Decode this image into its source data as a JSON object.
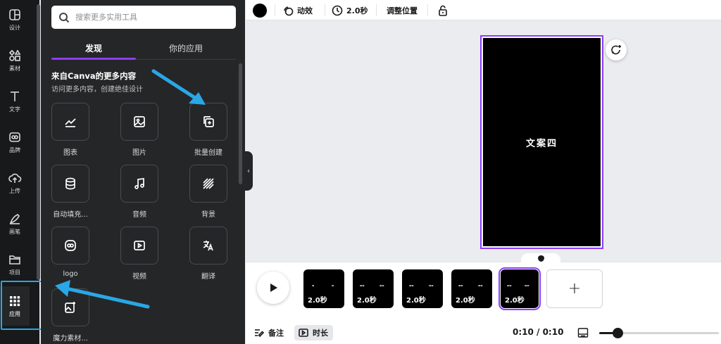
{
  "rail": {
    "items": [
      {
        "label": "设计",
        "icon": "layout-icon"
      },
      {
        "label": "素材",
        "icon": "shapes-icon"
      },
      {
        "label": "文字",
        "icon": "text-icon"
      },
      {
        "label": "品牌",
        "icon": "brand-icon"
      },
      {
        "label": "上传",
        "icon": "upload-cloud-icon"
      },
      {
        "label": "画笔",
        "icon": "draw-icon"
      },
      {
        "label": "项目",
        "icon": "folder-icon"
      },
      {
        "label": "应用",
        "icon": "apps-grid-icon"
      }
    ]
  },
  "panel": {
    "search_placeholder": "搜索更多实用工具",
    "tabs": [
      {
        "label": "发现",
        "active": true
      },
      {
        "label": "你的应用",
        "active": false
      }
    ],
    "section_title": "来自Canva的更多内容",
    "section_subtitle": "访问更多内容，创建绝佳设计",
    "apps": [
      {
        "label": "图表",
        "icon": "chart-icon"
      },
      {
        "label": "图片",
        "icon": "image-icon"
      },
      {
        "label": "批量创建",
        "icon": "bulk-create-icon"
      },
      {
        "label": "自动填充...",
        "icon": "database-icon"
      },
      {
        "label": "音频",
        "icon": "music-icon"
      },
      {
        "label": "背景",
        "icon": "pattern-icon"
      },
      {
        "label": "logo",
        "icon": "logo-icon"
      },
      {
        "label": "视频",
        "icon": "video-icon"
      },
      {
        "label": "翻译",
        "icon": "translate-icon"
      },
      {
        "label": "魔力素材...",
        "icon": "magic-media-icon"
      }
    ]
  },
  "toolbar": {
    "color": "#000000",
    "animate_label": "动效",
    "duration_label": "2.0秒",
    "position_label": "调整位置"
  },
  "canvas": {
    "page_text": "文案四",
    "accent": "#8b3dff"
  },
  "timeline": {
    "pages": [
      {
        "duration": "2.0秒",
        "active": false
      },
      {
        "duration": "2.0秒",
        "active": false
      },
      {
        "duration": "2.0秒",
        "active": false
      },
      {
        "duration": "2.0秒",
        "active": false
      },
      {
        "duration": "2.0秒",
        "active": true
      }
    ],
    "add_label": "+",
    "notes_label": "备注",
    "duration_toggle_label": "时长",
    "time_display": "0:10 / 0:10",
    "zoom_fraction": 0.15
  }
}
